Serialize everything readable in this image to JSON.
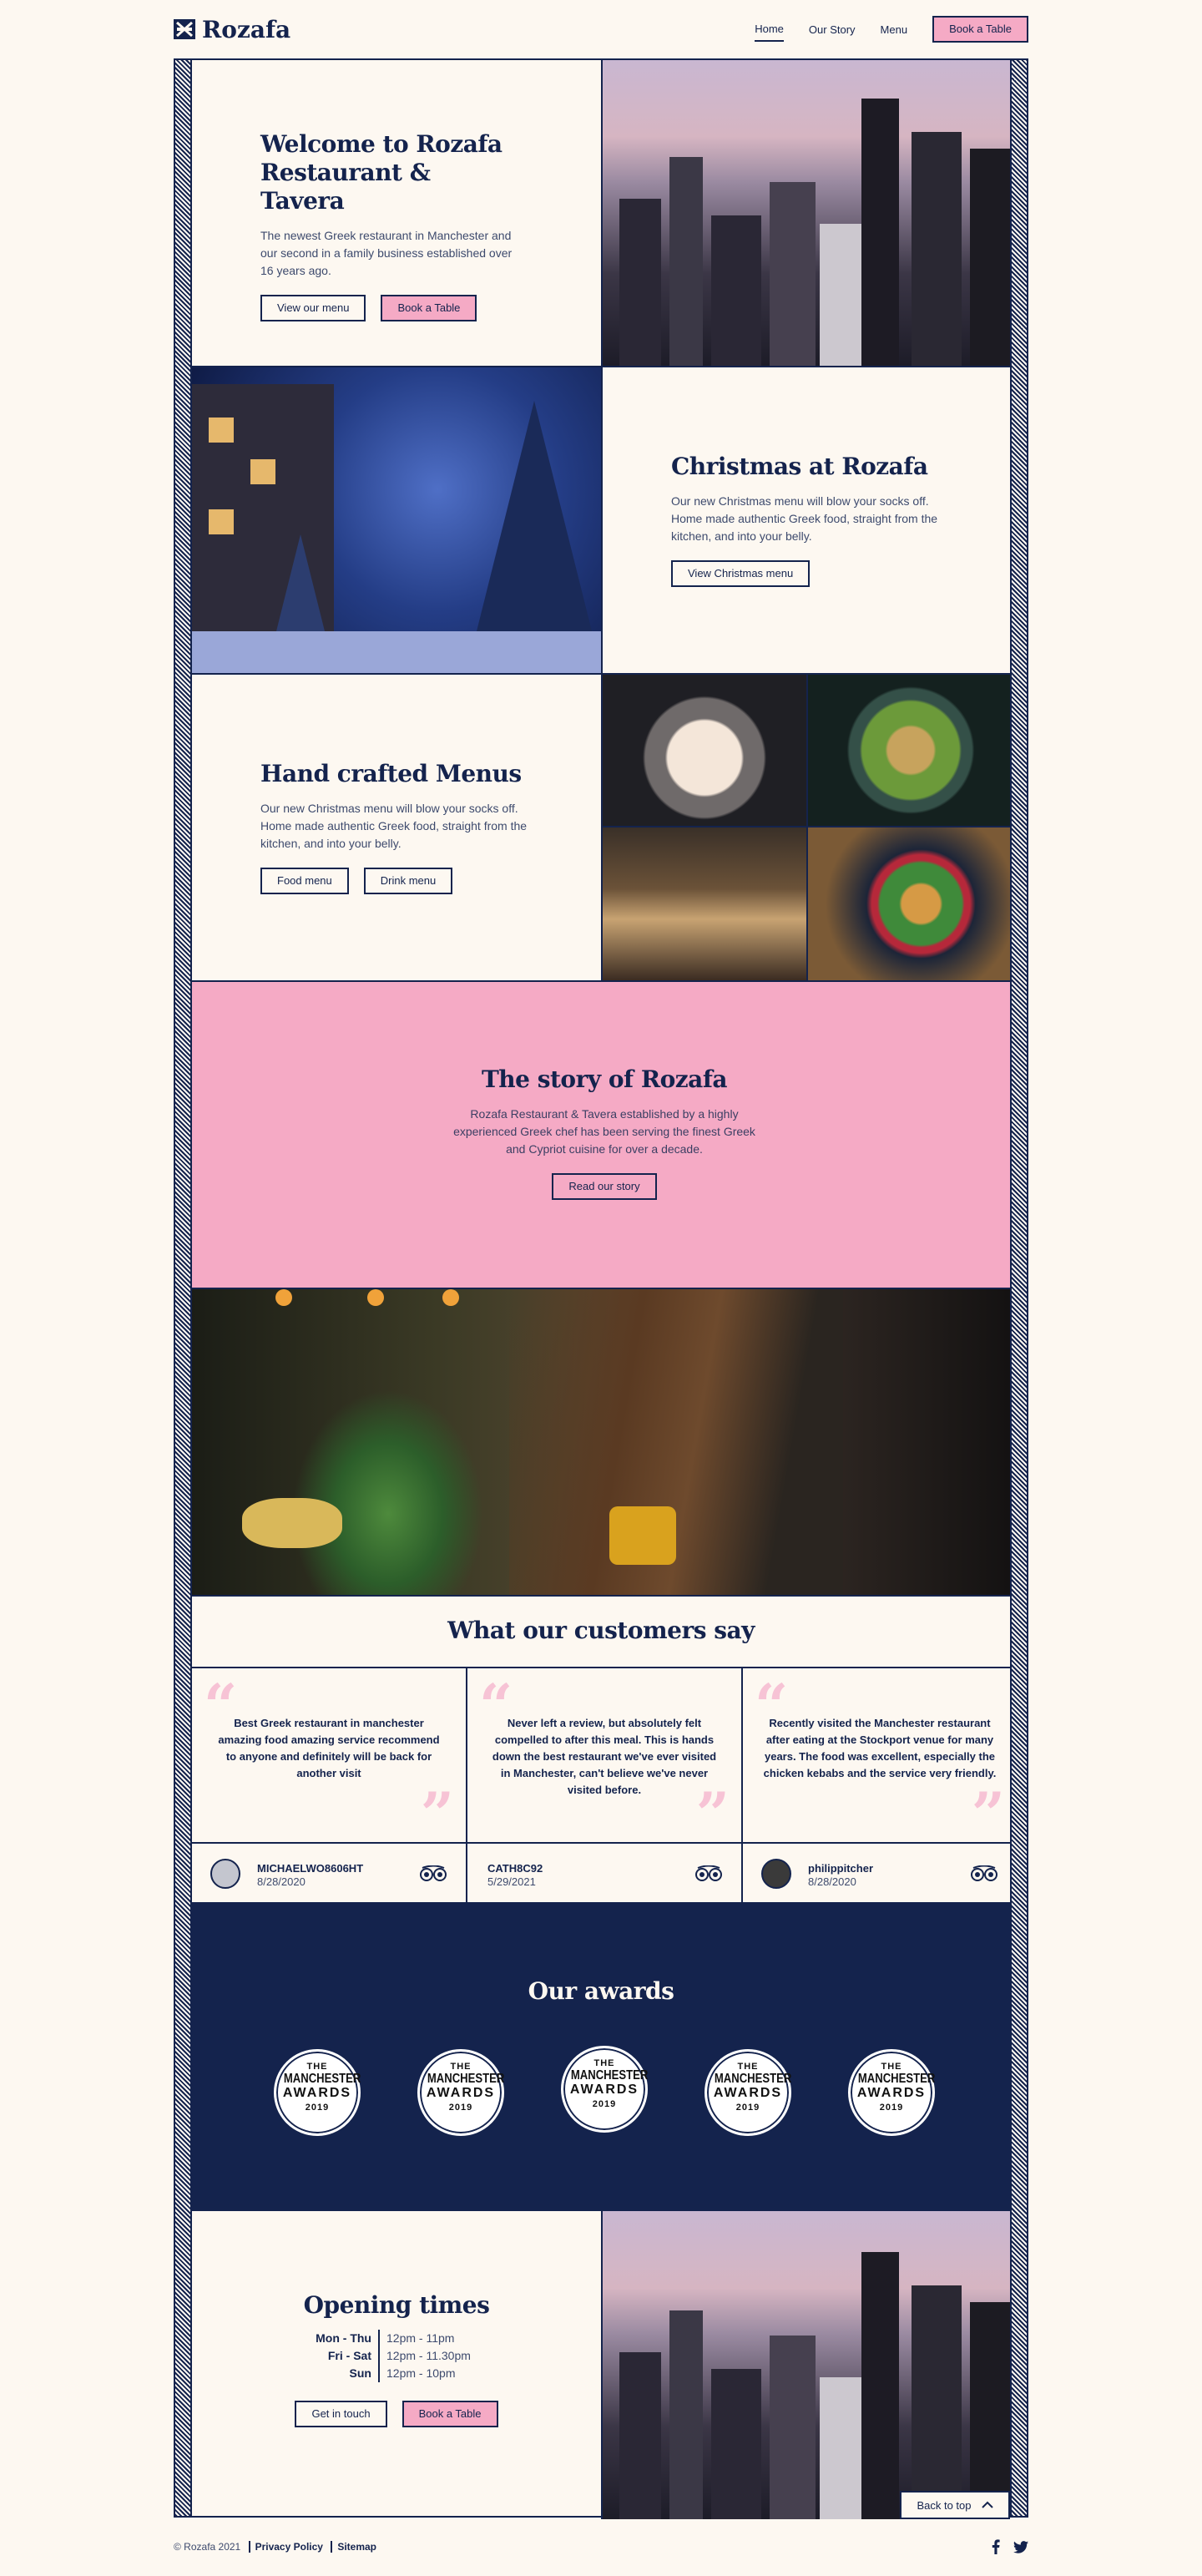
{
  "header": {
    "logo_text": "Rozafa",
    "nav": [
      {
        "label": "Home",
        "active": true
      },
      {
        "label": "Our Story"
      },
      {
        "label": "Menu"
      }
    ],
    "book_label": "Book a Table"
  },
  "hero": {
    "title_line1": "Welcome to Rozafa",
    "title_line2": "Restaurant & Tavera",
    "text": "The newest Greek restaurant in Manchester and our second in a family business established over 16 years ago.",
    "menu_button": "View our menu",
    "book_button": "Book a Table"
  },
  "christmas": {
    "title": "Christmas at Rozafa",
    "text": "Our new Christmas menu will blow your socks off. Home made authentic Greek food, straight from the kitchen, and into your belly.",
    "button": "View Christmas menu"
  },
  "menus": {
    "title": "Hand crafted Menus",
    "text": "Our new Christmas menu will blow your socks off. Home made authentic Greek food, straight from the kitchen, and into your belly.",
    "food_button": "Food menu",
    "drink_button": "Drink menu"
  },
  "story": {
    "title": "The story of Rozafa",
    "text": "Rozafa Restaurant & Tavera established by a highly experienced Greek chef has been serving the finest Greek and Cypriot cuisine for over a decade.",
    "button": "Read our story"
  },
  "reviews": {
    "title": "What our customers say",
    "items": [
      {
        "text": "Best Greek restaurant in manchester amazing food amazing service recommend to anyone and definitely will be back for another visit",
        "name": "MICHAELWO8606HT",
        "date": "8/28/2020"
      },
      {
        "text": "Never left a review, but absolutely felt compelled to after this meal. This is hands down the best restaurant we've ever visited in Manchester, can't believe we've never visited before.",
        "name": "CATH8C92",
        "date": "5/29/2021"
      },
      {
        "text": "Recently visited the Manchester restaurant after eating at the Stockport venue for many years. The food was excellent, especially the chicken kebabs and the service very friendly.",
        "name": "philippitcher",
        "date": "8/28/2020"
      }
    ]
  },
  "awards": {
    "title": "Our awards",
    "badge": {
      "the": "THE",
      "city": "MANCHESTER",
      "word": "AWARDS",
      "year": "2019"
    }
  },
  "opening": {
    "title": "Opening times",
    "rows": [
      {
        "day": "Mon - Thu",
        "hours": "12pm - 11pm"
      },
      {
        "day": "Fri - Sat",
        "hours": "12pm - 11.30pm"
      },
      {
        "day": "Sun",
        "hours": "12pm - 10pm"
      }
    ],
    "contact_button": "Get in touch",
    "book_button": "Book a Table",
    "back_to_top": "Back to top"
  },
  "footer": {
    "copyright": "© Rozafa 2021",
    "privacy": "Privacy Policy",
    "sitemap": "Sitemap"
  },
  "colors": {
    "navy": "#14234d",
    "pink": "#f5aac5",
    "cream": "#fdf8f1"
  }
}
